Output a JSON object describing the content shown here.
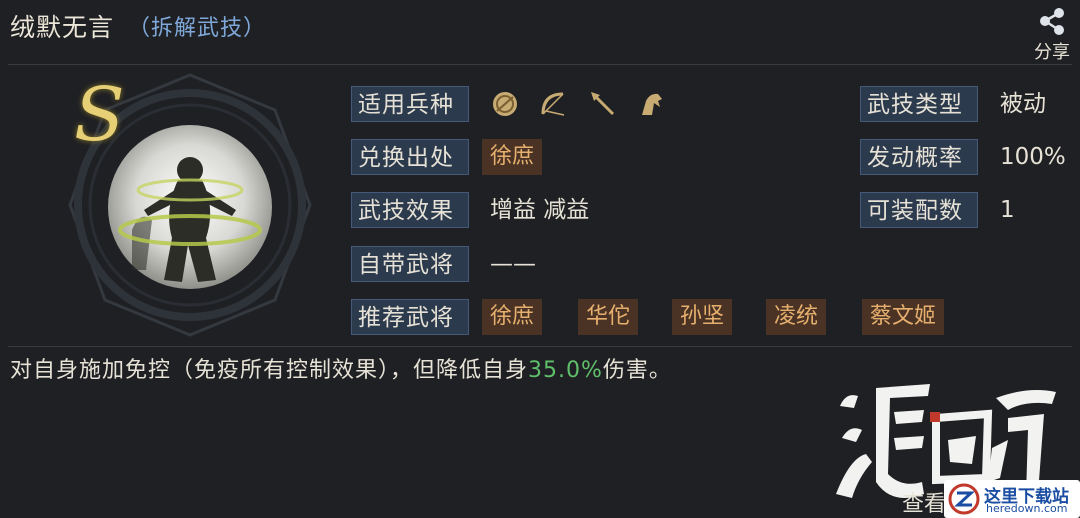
{
  "header": {
    "title": "绒默无言",
    "dismantle_link": "（拆解武技）",
    "share_label": "分享"
  },
  "skill": {
    "grade": "S",
    "applicable_troops_label": "适用兵种",
    "troop_icons": [
      "shield-icon",
      "bow-icon",
      "spear-icon",
      "horse-icon"
    ],
    "source_label": "兑换出处",
    "source_value": "徐庶",
    "effect_label": "武技效果",
    "effect_value": "增益 减益",
    "builtin_label": "自带武将",
    "builtin_value": "——",
    "recommended_label": "推荐武将",
    "recommended_generals": [
      "徐庶",
      "华佗",
      "孙坚",
      "凌统",
      "蔡文姬"
    ],
    "type_label": "武技类型",
    "type_value": "被动",
    "trigger_label": "发动概率",
    "trigger_value": "100%",
    "equip_label": "可装配数",
    "equip_value": "1"
  },
  "description": {
    "before": "对自身施加免控（免疫所有控制效果），但降低自身",
    "highlight": "35.0%",
    "after": "伤害。"
  },
  "footer": {
    "view_label": "查看"
  },
  "watermark": {
    "logo_text": "鸿图",
    "site_cn": "这里下载站",
    "site_en": "heredown.com"
  },
  "colors": {
    "background": "#1f2024",
    "label_bg": "#2c3a4d",
    "tag_bg": "#4a3325",
    "tag_text": "#e7b06e",
    "highlight": "#5fbf6b",
    "link": "#7fa8d9",
    "grade": "#e6cf75"
  }
}
